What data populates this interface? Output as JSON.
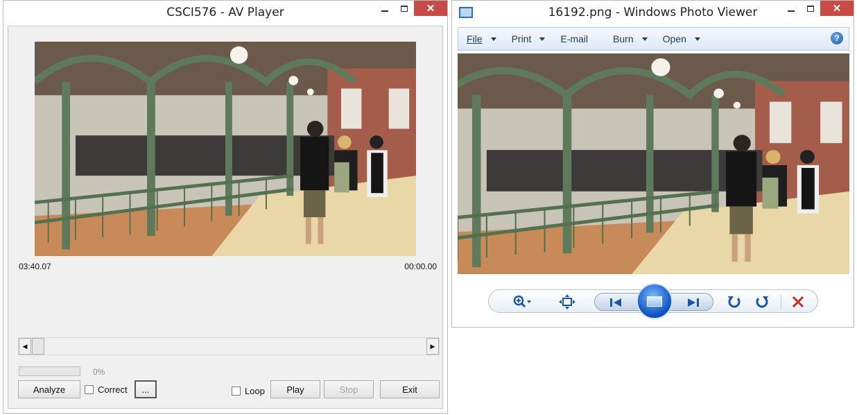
{
  "av_player": {
    "title": "CSCI576 - AV Player",
    "time_left": "03:40.07",
    "time_right": "00:00.00",
    "progress_percent": 0,
    "progress_label": "0%",
    "buttons": {
      "analyze": "Analyze",
      "browse": "...",
      "play": "Play",
      "stop": "Stop",
      "exit": "Exit"
    },
    "checkboxes": {
      "correct": "Correct",
      "loop": "Loop"
    },
    "scroll_left": "◀",
    "scroll_right": "▶"
  },
  "photo_viewer": {
    "title": "16192.png - Windows Photo Viewer",
    "menu": [
      "File",
      "Print",
      "E-mail",
      "Burn",
      "Open"
    ],
    "help": "?",
    "toolbar_icons": [
      "zoom-icon",
      "actual-size-icon",
      "previous-icon",
      "slideshow-icon",
      "next-icon",
      "rotate-ccw-icon",
      "rotate-cw-icon",
      "delete-icon"
    ]
  },
  "window_caption": {
    "close": "✕"
  },
  "colors": {
    "close_red": "#c94b45",
    "accent_blue": "#1a56a8",
    "delete_red": "#c0302a"
  }
}
